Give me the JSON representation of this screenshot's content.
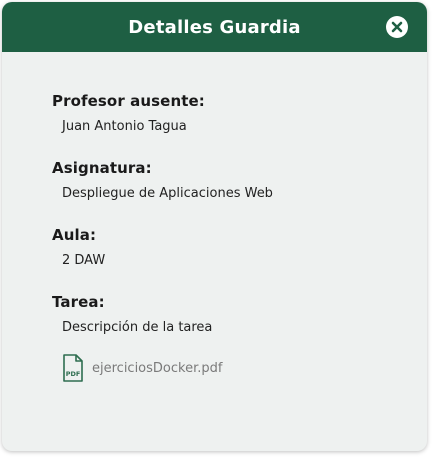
{
  "dialog": {
    "title": "Detalles Guardia",
    "close_icon": "close-circle-icon"
  },
  "fields": {
    "profesor": {
      "label": "Profesor ausente:",
      "value": "Juan Antonio Tagua"
    },
    "asignatura": {
      "label": "Asignatura:",
      "value": "Despliegue de Aplicaciones Web"
    },
    "aula": {
      "label": "Aula:",
      "value": "2 DAW"
    },
    "tarea": {
      "label": "Tarea:",
      "value": "Descripción de la tarea"
    }
  },
  "attachment": {
    "icon": "pdf-file-icon",
    "icon_text": "PDF",
    "filename": "ejerciciosDocker.pdf"
  },
  "colors": {
    "header": "#1e5f43",
    "panel": "#eef1f0",
    "pdf_icon": "#2e6e50"
  }
}
